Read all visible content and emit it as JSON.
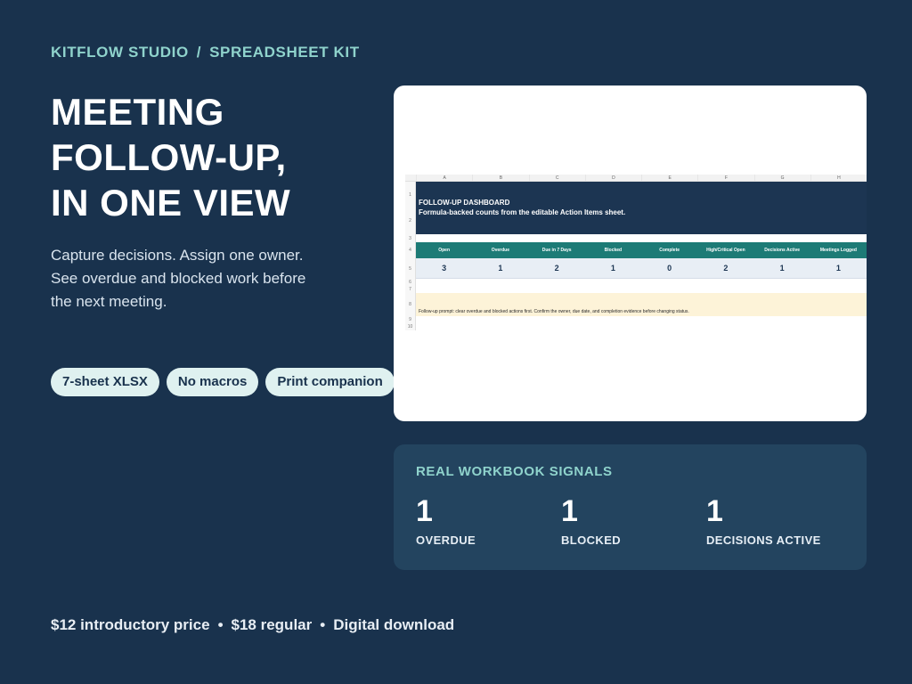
{
  "breadcrumb": {
    "brand": "KITFLOW STUDIO",
    "separator": "/",
    "product": "SPREADSHEET KIT"
  },
  "headline": [
    "MEETING",
    "FOLLOW-UP,",
    "IN ONE VIEW"
  ],
  "subcopy": "Capture decisions. Assign one owner. See overdue and blocked work before the next meeting.",
  "pills": [
    "7-sheet XLSX",
    "No macros",
    "Print companion"
  ],
  "sheet": {
    "columns": [
      "A",
      "B",
      "C",
      "D",
      "E",
      "F",
      "G",
      "H"
    ],
    "row_numbers": [
      "1",
      "2",
      "3",
      "4",
      "5",
      "6",
      "7",
      "8",
      "9",
      "10"
    ],
    "title": "FOLLOW-UP DASHBOARD",
    "subtitle": "Formula-backed counts from the editable Action Items sheet.",
    "headers": [
      "Open",
      "Overdue",
      "Due in 7 Days",
      "Blocked",
      "Complete",
      "High/Critical Open",
      "Decisions Active",
      "Meetings Logged"
    ],
    "values": [
      "3",
      "1",
      "2",
      "1",
      "0",
      "2",
      "1",
      "1"
    ],
    "prompt": "Follow-up prompt: clear overdue and blocked actions first. Confirm the owner, due date, and completion evidence before changing status."
  },
  "signals": {
    "title": "REAL WORKBOOK SIGNALS",
    "items": [
      {
        "value": "1",
        "label": "OVERDUE"
      },
      {
        "value": "1",
        "label": "BLOCKED"
      },
      {
        "value": "1",
        "label": "DECISIONS ACTIVE"
      }
    ]
  },
  "footer": {
    "price_intro": "$12 introductory price",
    "price_regular": "$18 regular",
    "delivery": "Digital download",
    "bullet": "•"
  },
  "colors": {
    "background": "#19324d",
    "accent": "#8fd3cc",
    "sheet_header": "#1d7b76",
    "sheet_title_bg": "#1c3552",
    "prompt_bg": "#fdf3d8"
  }
}
